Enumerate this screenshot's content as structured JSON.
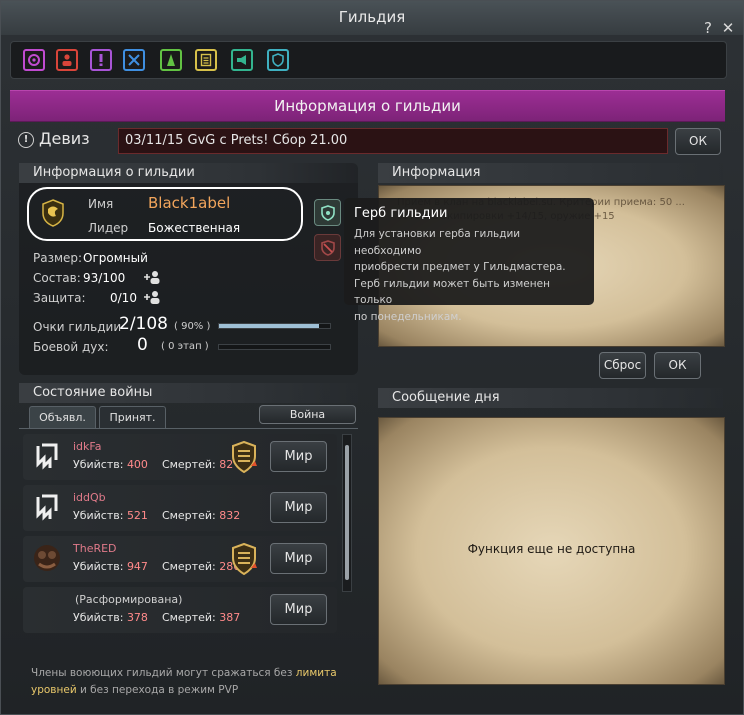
{
  "window": {
    "title": "Гильдия",
    "help": "?",
    "close": "✕"
  },
  "toolbar": {
    "tools": [
      {
        "icon": "guild-emblem-icon",
        "color": "#c04bd0"
      },
      {
        "icon": "members-icon",
        "color": "#d9453a"
      },
      {
        "icon": "quest-icon",
        "color": "#a855d6"
      },
      {
        "icon": "war-icon",
        "color": "#3f8fe0"
      },
      {
        "icon": "skills-icon",
        "color": "#62c243"
      },
      {
        "icon": "notice-icon",
        "color": "#d6c04a"
      },
      {
        "icon": "announce-icon",
        "color": "#33b48f"
      },
      {
        "icon": "defense-icon",
        "color": "#3fb0c0"
      }
    ]
  },
  "banner": {
    "title": "Информация о гильдии"
  },
  "motto": {
    "label": "Девиз",
    "value": "03/11/15 GvG c Prets! Сбор 21.00",
    "ok": "ОК"
  },
  "guild_info": {
    "header": "Информация о гильдии",
    "name_label": "Имя",
    "name_value": "Black1abel",
    "leader_label": "Лидер",
    "leader_value": "Божественная",
    "size_label": "Размер:",
    "size_value": "Огромный",
    "members_label": "Состав:",
    "members_value": "93/100",
    "defense_label": "Защита:",
    "defense_value": "0/10",
    "points_label": "Очки гильдии",
    "points_value": "2/108",
    "points_pct": "( 90% )",
    "points_fraction": 0.9,
    "spirit_label": "Боевой дух:",
    "spirit_value": "0",
    "spirit_stage": "( 0 этап )",
    "spirit_fraction": 0
  },
  "info_panel": {
    "header": "Информация",
    "text": "Прием в клан на blacklabel.su. Критерии приема: 50 ... заточка экипировки +14/15, оружие +15",
    "reset": "Сброс",
    "ok": "ОК"
  },
  "tooltip": {
    "title": "Герб гильдии",
    "lines": [
      "Для установки герба гильдии необходимо",
      "приобрести предмет у Гильдмастера.",
      "Герб гильдии может быть изменен только",
      "по понедельникам."
    ]
  },
  "war": {
    "header": "Состояние войны",
    "tabs": [
      "Объявл.",
      "Принят."
    ],
    "war_button": "Война",
    "kills_label": "Убийств:",
    "deaths_label": "Смертей:",
    "rows": [
      {
        "name": "idkFa",
        "kills": "400",
        "deaths": "82",
        "action": "Мир"
      },
      {
        "name": "iddQb",
        "kills": "521",
        "deaths": "832",
        "action": "Мир"
      },
      {
        "name": "TheRED",
        "kills": "947",
        "deaths": "286",
        "action": "Мир"
      },
      {
        "name": "(Расформирована)",
        "kills": "378",
        "deaths": "387",
        "action": "Мир"
      }
    ],
    "note_prefix": "Члены воюющих гильдий могут сражаться без ",
    "note_highlight": "лимита уровней",
    "note_suffix": " и без перехода в режим PVP"
  },
  "motd": {
    "header": "Сообщение дня",
    "text": "Функция еще не доступна"
  }
}
